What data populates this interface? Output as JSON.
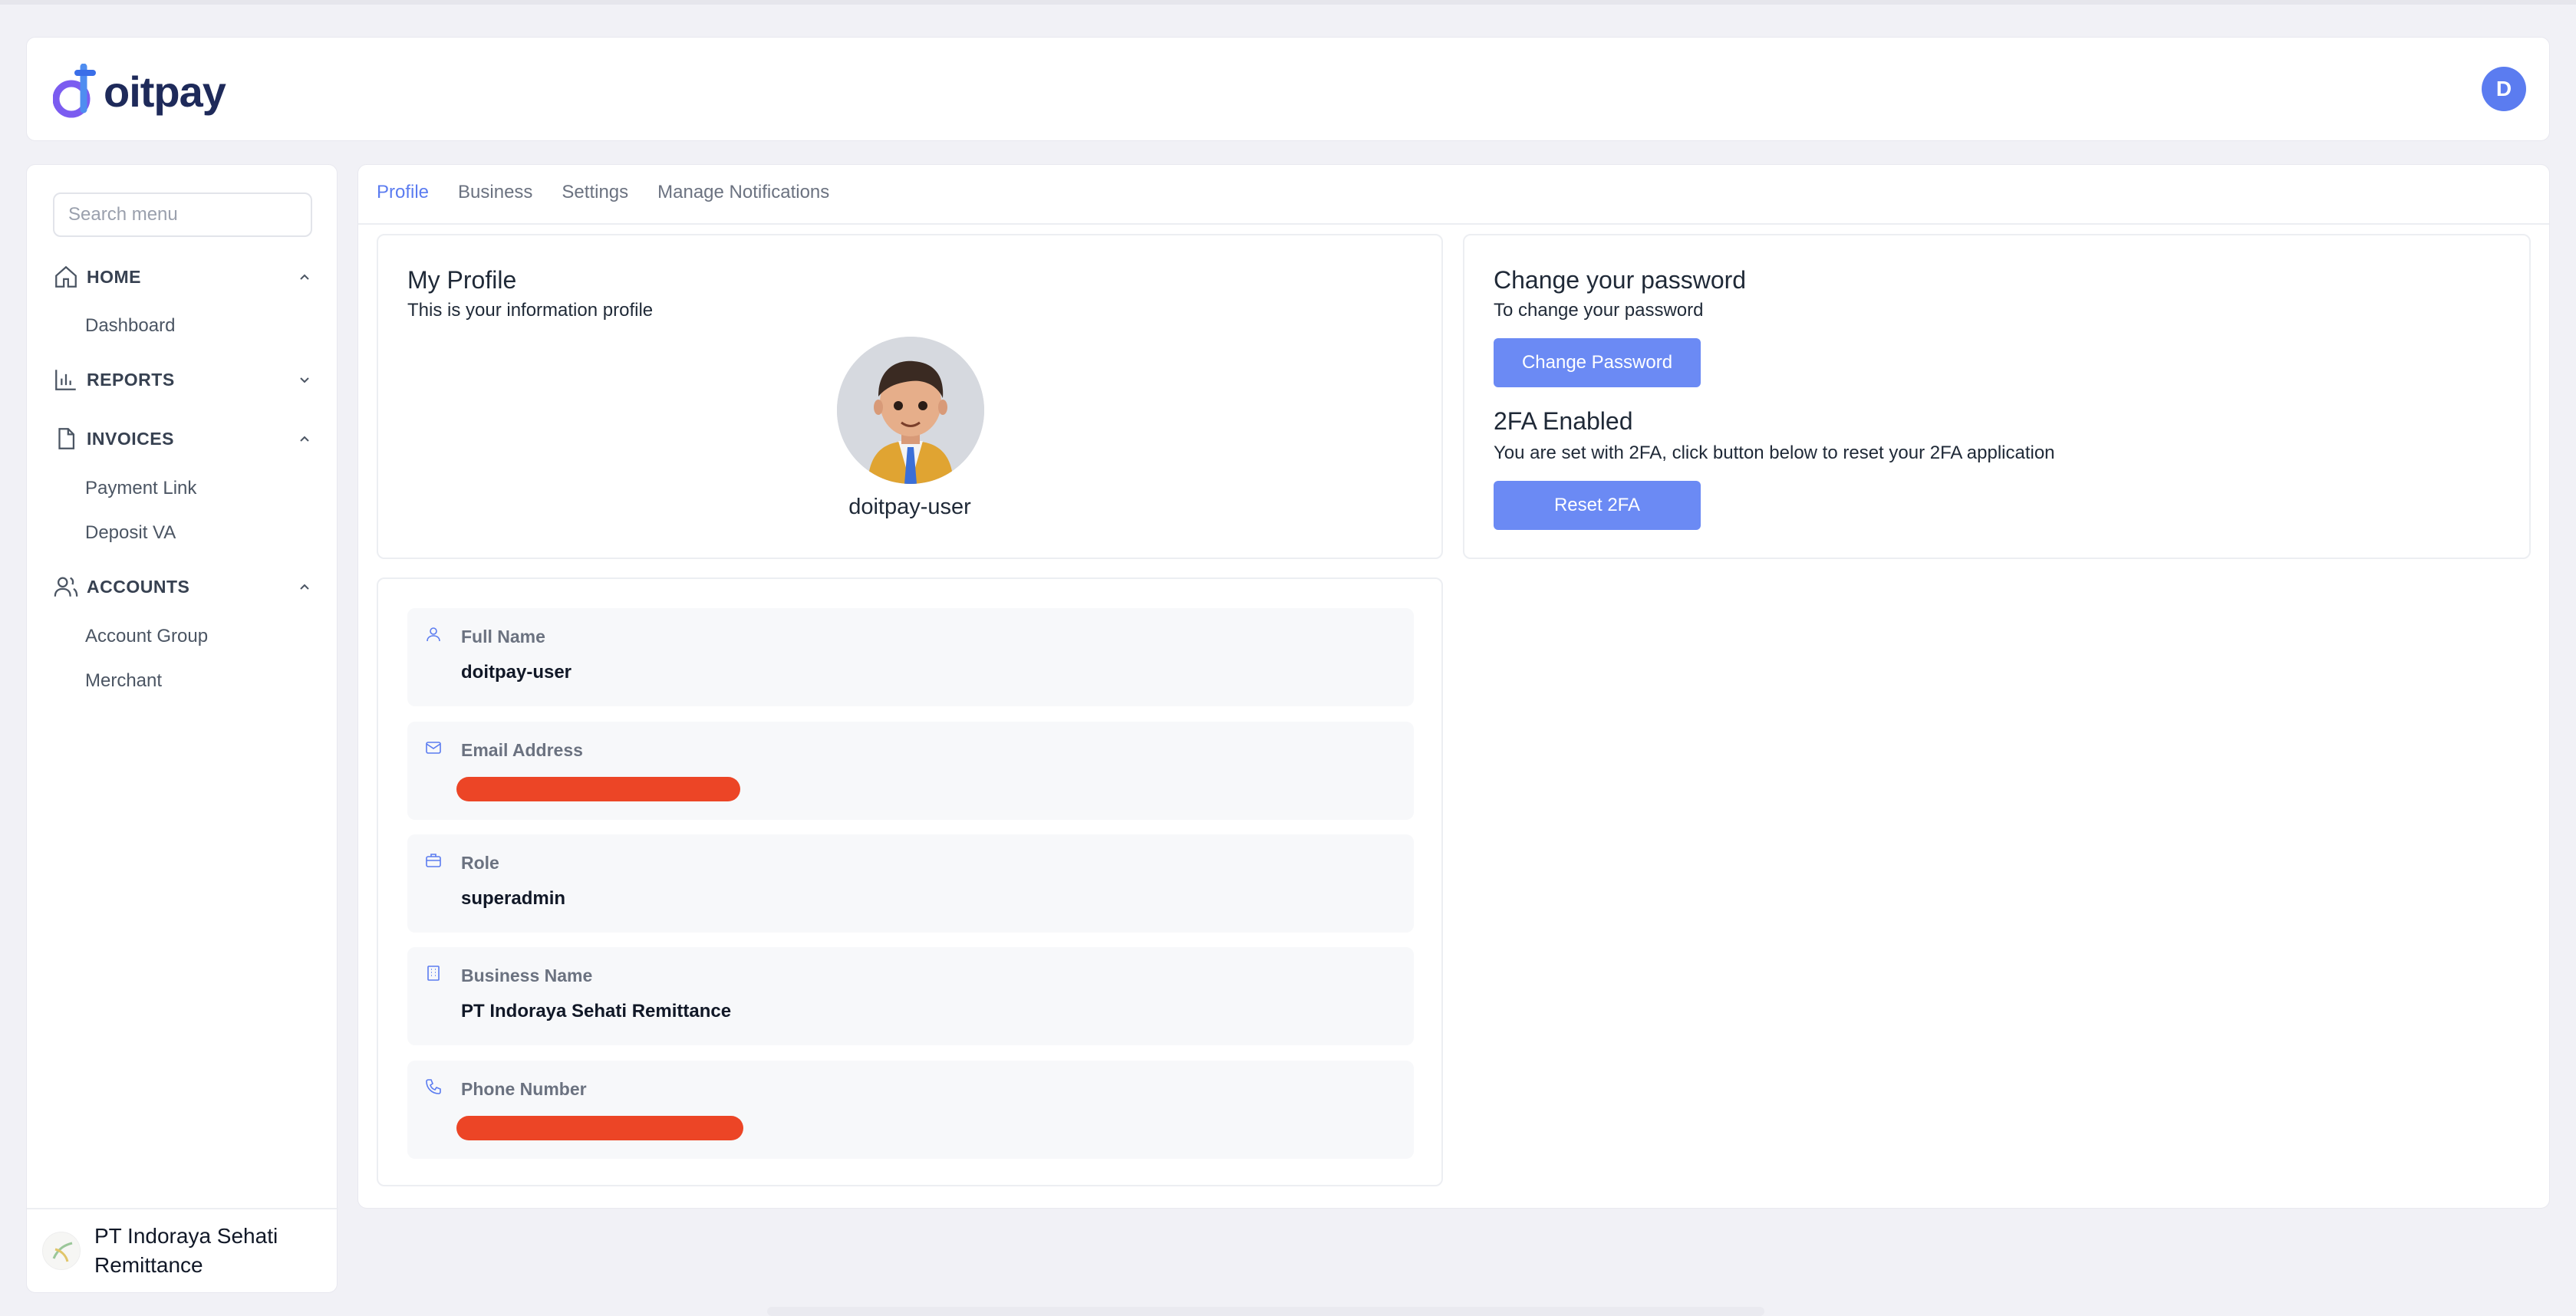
{
  "header": {
    "brand": "oitpay",
    "user_initial": "D"
  },
  "sidebar": {
    "search_placeholder": "Search menu",
    "sections": [
      {
        "label": "HOME",
        "items": [
          "Dashboard"
        ]
      },
      {
        "label": "REPORTS",
        "items": []
      },
      {
        "label": "INVOICES",
        "items": [
          "Payment Link",
          "Deposit VA"
        ]
      },
      {
        "label": "ACCOUNTS",
        "items": [
          "Account Group",
          "Merchant"
        ]
      }
    ],
    "footer_company": "PT Indoraya Sehati Remittance"
  },
  "tabs": [
    "Profile",
    "Business",
    "Settings",
    "Manage Notifications"
  ],
  "profile": {
    "title": "My Profile",
    "subtitle": "This is your information profile",
    "username": "doitpay-user"
  },
  "fields": {
    "full_name": {
      "label": "Full Name",
      "value": "doitpay-user"
    },
    "email": {
      "label": "Email Address"
    },
    "role": {
      "label": "Role",
      "value": "superadmin"
    },
    "business": {
      "label": "Business Name",
      "value": "PT Indoraya Sehati Remittance"
    },
    "phone": {
      "label": "Phone Number"
    }
  },
  "password": {
    "title": "Change your password",
    "subtitle": "To change your password",
    "button": "Change Password"
  },
  "twofa": {
    "title": "2FA Enabled",
    "subtitle": "You are set with 2FA, click button below to reset your 2FA application",
    "button": "Reset 2FA"
  },
  "colors": {
    "accent": "#5b7cf0",
    "button": "#6b8af4",
    "redaction": "#ec4526"
  }
}
